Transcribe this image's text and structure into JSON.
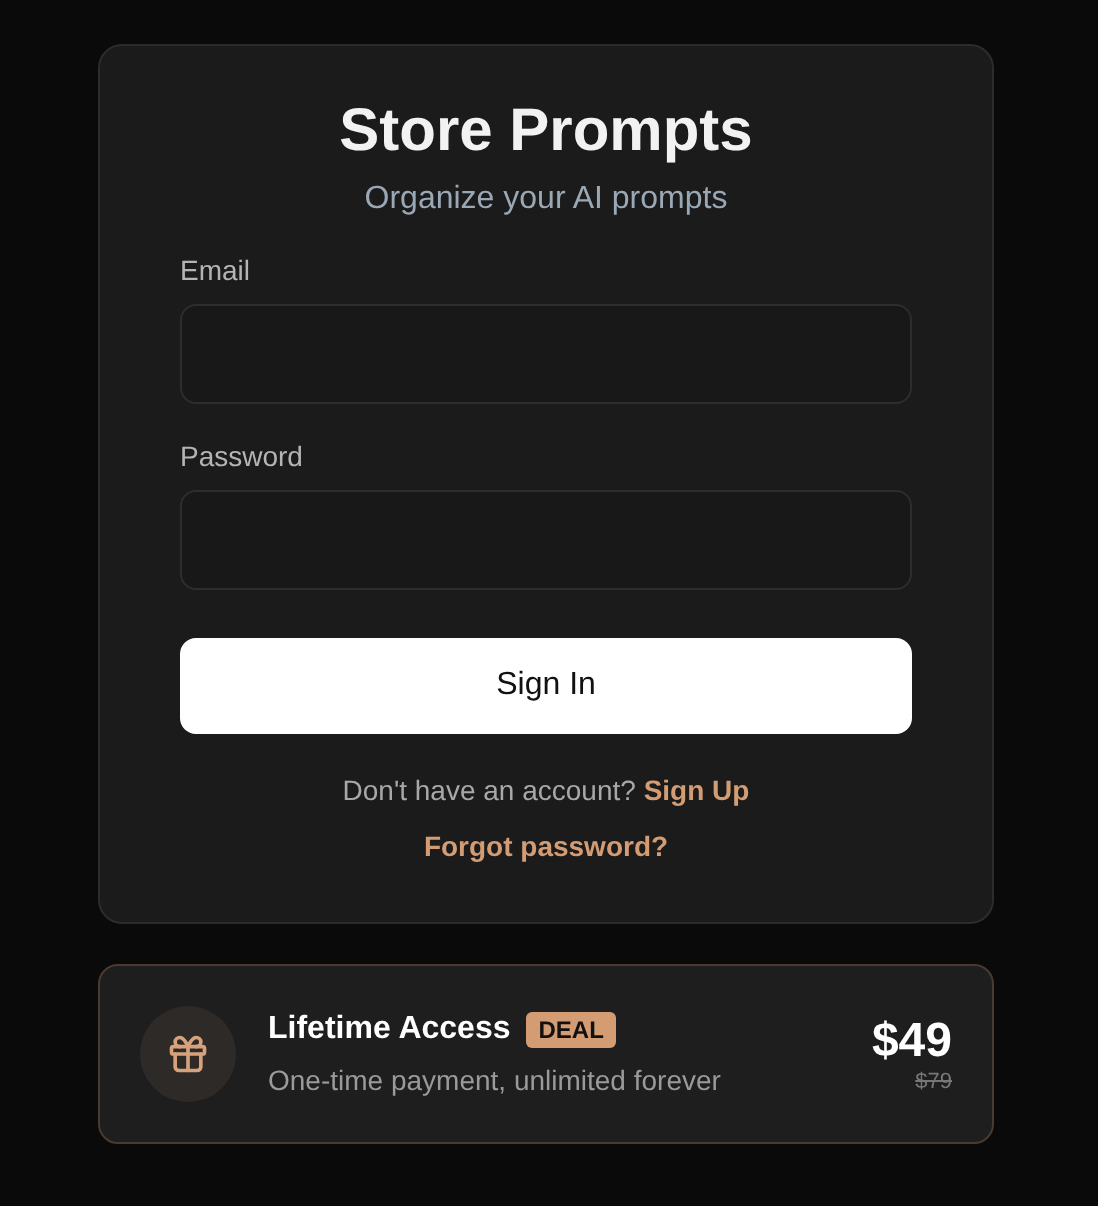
{
  "login": {
    "title": "Store Prompts",
    "subtitle": "Organize your AI prompts",
    "fields": [
      {
        "label": "Email"
      },
      {
        "label": "Password"
      }
    ],
    "submit": "Sign In",
    "signup_prompt": "Don't have an account?",
    "signup_link": "Sign Up",
    "forgot": "Forgot password?"
  },
  "offer": {
    "title": "Lifetime Access",
    "badge": "DEAL",
    "description": "One-time payment, unlimited forever",
    "price": "$49",
    "old_price": "$79"
  }
}
